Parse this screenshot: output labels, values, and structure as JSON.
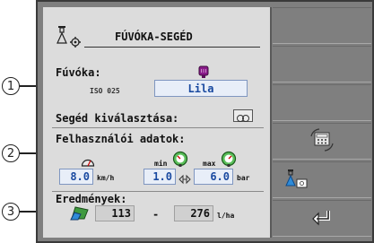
{
  "title": "FÚVÓKA-SEGÉD",
  "nozzle": {
    "label": "Fúvóka:",
    "iso": "ISO 025",
    "color": "Lila",
    "color_hex": "#8a1a8a"
  },
  "helper": {
    "label": "Segéd kiválasztása:"
  },
  "user_data": {
    "label": "Felhasználói adatok:",
    "speed": "8.0",
    "speed_unit": "km/h",
    "min_label": "min",
    "max_label": "max",
    "p_min": "1.0",
    "p_max": "6.0",
    "pressure_unit": "bar"
  },
  "results": {
    "label": "Eredmények:",
    "from": "113",
    "dash": "-",
    "to": "276",
    "unit": "l/ha"
  },
  "callouts": [
    "1",
    "2",
    "3"
  ],
  "colors": {
    "screen": "#7f7f7f",
    "panel": "#dcdcdc",
    "value_text": "#1a4aa0",
    "accent_blue": "#2e8bd8",
    "accent_green": "#3f9a3f"
  },
  "softkey_icons": [
    "empty",
    "empty",
    "empty",
    "calculator-swap-icon",
    "nozzle-settings-icon",
    "return-arrow-icon"
  ]
}
